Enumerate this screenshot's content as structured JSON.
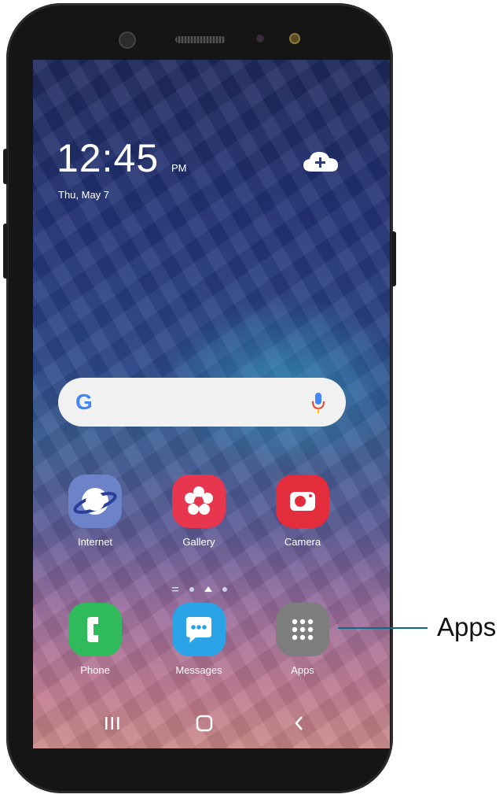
{
  "status": {
    "time": "12:45",
    "ampm": "PM",
    "date": "Thu, May 7"
  },
  "search": {
    "g": "G"
  },
  "apps_row1": [
    {
      "label": "Internet",
      "icon": "internet-icon"
    },
    {
      "label": "Gallery",
      "icon": "gallery-icon"
    },
    {
      "label": "Camera",
      "icon": "camera-icon"
    }
  ],
  "apps_row2": [
    {
      "label": "Phone",
      "icon": "phone-icon"
    },
    {
      "label": "Messages",
      "icon": "messages-icon"
    },
    {
      "label": "Apps",
      "icon": "apps-grid-icon"
    }
  ],
  "callout": {
    "label": "Apps"
  },
  "colors": {
    "internet": "#6d83c9",
    "gallery": "#e8364f",
    "camera": "#e42d3c",
    "phone": "#2fba5c",
    "messages": "#2aa4e6",
    "apps": "#7d7d7d",
    "callout_line": "#0a6a8a"
  }
}
